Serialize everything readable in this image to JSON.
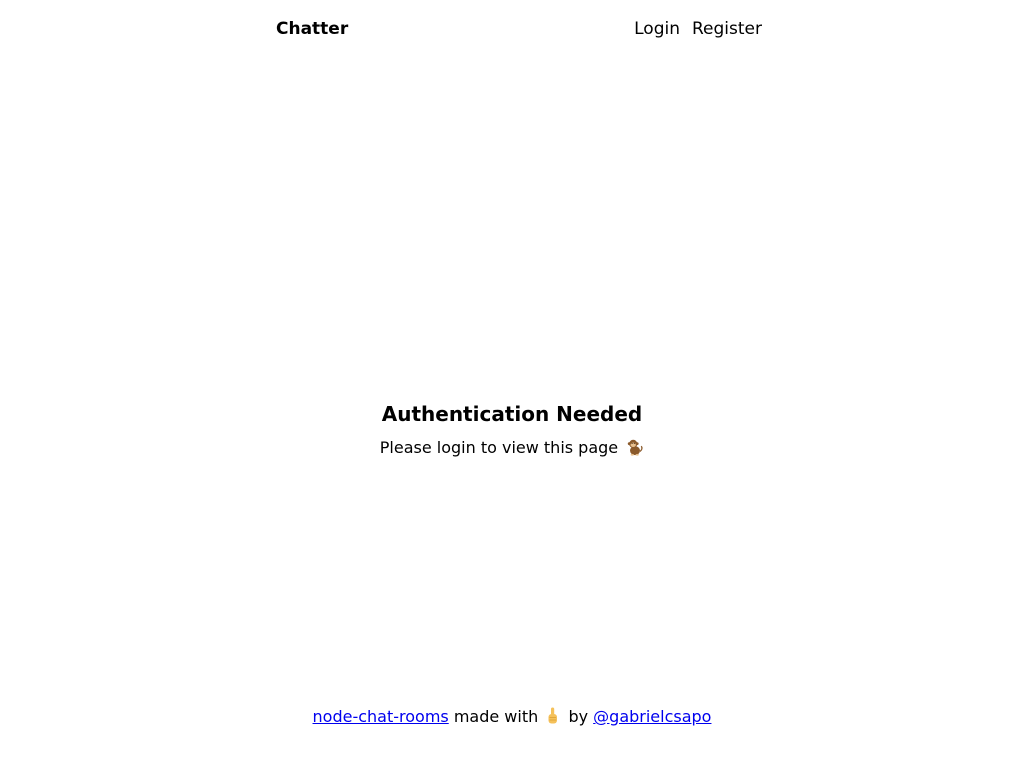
{
  "navbar": {
    "brand": "Chatter",
    "links": [
      {
        "label": "Login"
      },
      {
        "label": "Register"
      }
    ]
  },
  "main": {
    "heading": "Authentication Needed",
    "message": "Please login to view this page",
    "message_icon": "monkey-icon"
  },
  "footer": {
    "project_link": "node-chat-rooms",
    "made_with": "made with",
    "made_with_icon": "pointing-finger-icon",
    "by": "by",
    "author_link": "@gabrielcsapo"
  },
  "colors": {
    "link": "#0000ee",
    "text": "#000000",
    "background": "#ffffff"
  }
}
